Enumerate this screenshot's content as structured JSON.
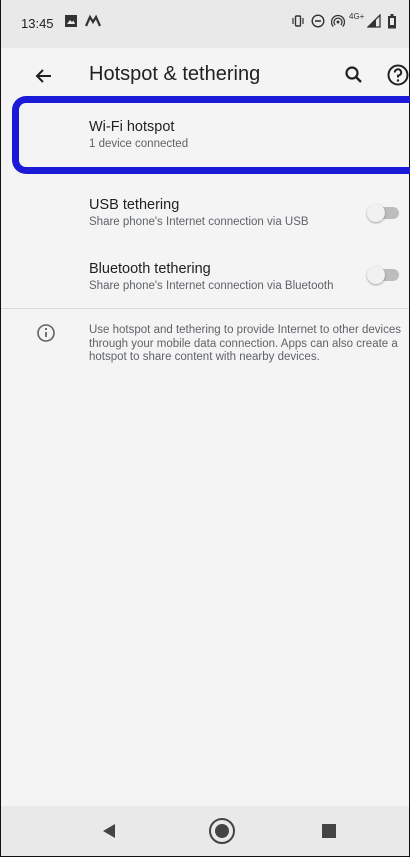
{
  "status_bar": {
    "time": "13:45",
    "network_label": "4G+"
  },
  "app_bar": {
    "title": "Hotspot & tethering"
  },
  "settings": [
    {
      "primary": "Wi-Fi hotspot",
      "secondary": "1 device connected"
    },
    {
      "primary": "USB tethering",
      "secondary": "Share phone's Internet connection via USB",
      "toggle_on": false
    },
    {
      "primary": "Bluetooth tethering",
      "secondary": "Share phone's Internet connection via Bluetooth",
      "toggle_on": false
    }
  ],
  "info": {
    "text": "Use hotspot and tethering to provide Internet to other devices through your mobile data connection. Apps can also create a hotspot to share content with nearby devices."
  },
  "colors": {
    "highlight": "#1a1ad8",
    "background": "#f4f4f4",
    "system_bar": "#e9e9e9"
  },
  "icons": [
    "back-arrow-icon",
    "search-icon",
    "help-icon",
    "info-icon",
    "nav-back-icon",
    "nav-home-icon",
    "nav-recents-icon"
  ]
}
